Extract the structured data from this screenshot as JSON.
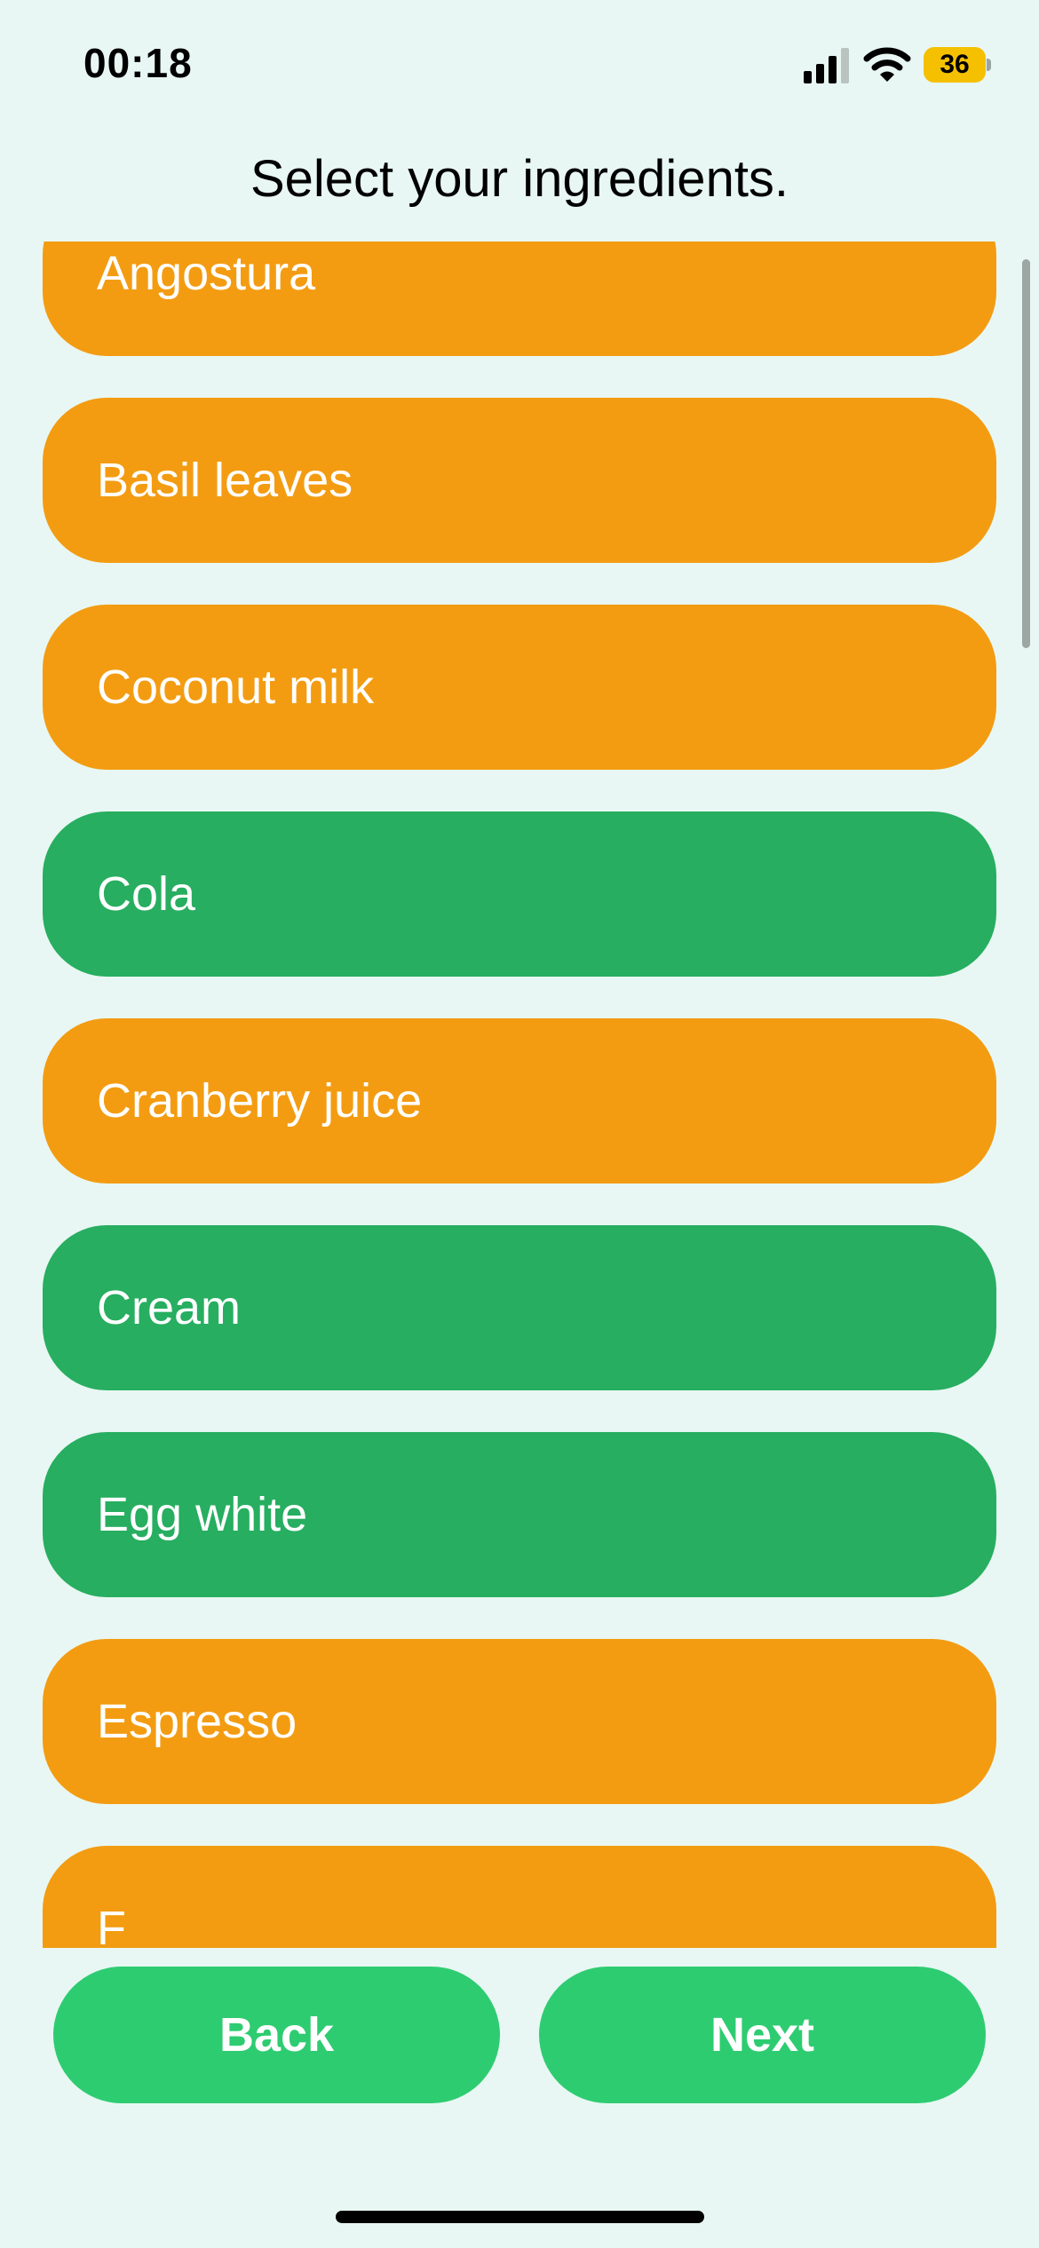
{
  "status_bar": {
    "time": "00:18",
    "battery_level": "36",
    "battery_color": "#F5C000",
    "icons": [
      "signal-icon",
      "wifi-icon",
      "battery-icon"
    ]
  },
  "header": {
    "title": "Select your ingredients."
  },
  "colors": {
    "background": "#E8F7F3",
    "unselected": "#F39C12",
    "selected": "#27AE60",
    "button": "#2ECC71"
  },
  "ingredients": [
    {
      "label": "Angostura",
      "selected": false
    },
    {
      "label": "Basil leaves",
      "selected": false
    },
    {
      "label": "Coconut milk",
      "selected": false
    },
    {
      "label": "Cola",
      "selected": true
    },
    {
      "label": "Cranberry juice",
      "selected": false
    },
    {
      "label": "Cream",
      "selected": true
    },
    {
      "label": "Egg white",
      "selected": true
    },
    {
      "label": "Espresso",
      "selected": false
    },
    {
      "label": "F",
      "selected": false
    }
  ],
  "footer": {
    "back_label": "Back",
    "next_label": "Next"
  }
}
